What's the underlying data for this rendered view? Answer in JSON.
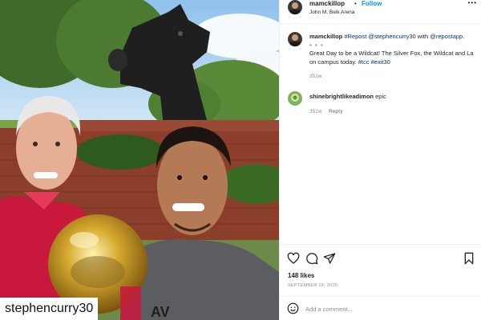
{
  "photo": {
    "alt_caption": "stephencurry30"
  },
  "header": {
    "username": "mamckillop",
    "separator": "•",
    "follow_label": "Follow",
    "location": "John M. Belk Arena",
    "more_icon": "more-horizontal-icon"
  },
  "caption": {
    "username": "mamckillop",
    "repost_tag": "#Repost",
    "mention": "@stephencurry30",
    "with_text": "with",
    "app_mention": "@repostapp.",
    "edited_marker": "• • •",
    "body_text_1": "Great Day to be a Wildcat! The Silver Fox, the Wildcat and La",
    "body_text_2": "on campus today.",
    "hashtag_1": "#tcc",
    "hashtag_2": "#exit30",
    "time": "351w"
  },
  "comment": {
    "username": "shinebrightlikeadimon",
    "text": "epic",
    "time": "351w",
    "reply_label": "Reply"
  },
  "actions": {
    "like_icon": "heart-icon",
    "comment_icon": "comment-icon",
    "share_icon": "share-icon",
    "save_icon": "bookmark-icon"
  },
  "likes": "148 likes",
  "date": "SEPTEMBER 18, 2015",
  "add_comment": {
    "emoji_icon": "emoji-icon",
    "placeholder": "Add a comment..."
  },
  "colors": {
    "follow_blue": "#0095f6",
    "link_navy": "#00376b",
    "muted_gray": "#8e8e8e",
    "text_dark": "#262626"
  }
}
